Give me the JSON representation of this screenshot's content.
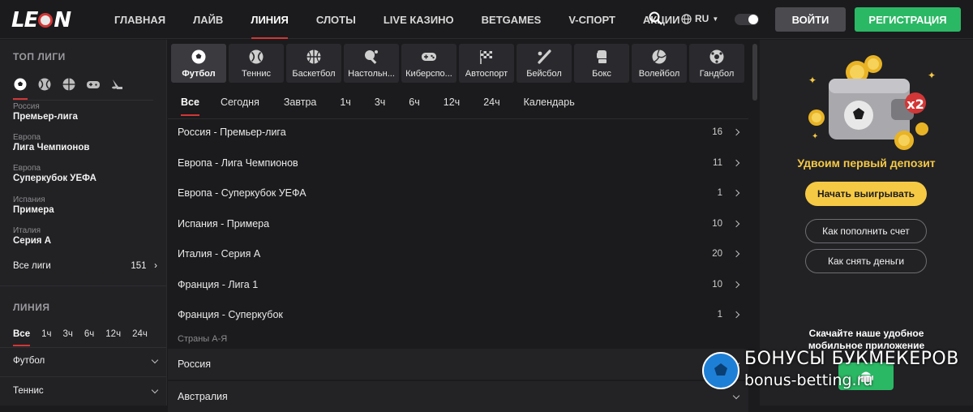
{
  "header": {
    "logo": "LEON",
    "nav": [
      "ГЛАВНАЯ",
      "ЛАЙВ",
      "ЛИНИЯ",
      "СЛОТЫ",
      "LIVE КАЗИНО",
      "BETGAMES",
      "V-СПОРТ",
      "АКЦИИ"
    ],
    "active_nav": "ЛИНИЯ",
    "lang": "RU",
    "login": "ВОЙТИ",
    "register": "РЕГИСТРАЦИЯ",
    "colors": {
      "accent": "#d23636",
      "green": "#2bb865",
      "yellow": "#f6c945"
    }
  },
  "sidebar": {
    "top_heading": "ТОП ЛИГИ",
    "top_leagues": [
      {
        "country": "Россия",
        "name": "Премьер-лига"
      },
      {
        "country": "Европа",
        "name": "Лига Чемпионов"
      },
      {
        "country": "Европа",
        "name": "Суперкубок УЕФА"
      },
      {
        "country": "Испания",
        "name": "Примера"
      },
      {
        "country": "Италия",
        "name": "Серия А"
      }
    ],
    "all_leagues_label": "Все лиги",
    "all_leagues_count": "151",
    "line_heading": "ЛИНИЯ",
    "time_filters": [
      "Все",
      "1ч",
      "3ч",
      "6ч",
      "12ч",
      "24ч"
    ],
    "sports": [
      "Футбол",
      "Теннис"
    ]
  },
  "sports_bar": [
    "Футбол",
    "Теннис",
    "Баскетбол",
    "Настольн...",
    "Киберспо...",
    "Автоспорт",
    "Бейсбол",
    "Бокс",
    "Волейбол",
    "Гандбол"
  ],
  "time_tabs": [
    "Все",
    "Сегодня",
    "Завтра",
    "1ч",
    "3ч",
    "6ч",
    "12ч",
    "24ч",
    "Календарь"
  ],
  "leagues": [
    {
      "name": "Россия - Премьер-лига",
      "count": "16"
    },
    {
      "name": "Европа - Лига Чемпионов",
      "count": "11"
    },
    {
      "name": "Европа - Суперкубок УЕФА",
      "count": "1"
    },
    {
      "name": "Испания - Примера",
      "count": "10"
    },
    {
      "name": "Италия - Серия А",
      "count": "20"
    },
    {
      "name": "Франция - Лига 1",
      "count": "10"
    },
    {
      "name": "Франция - Суперкубок",
      "count": "1"
    }
  ],
  "countries_label": "Страны А-Я",
  "countries": [
    "Россия",
    "Австралия"
  ],
  "promo": {
    "badge": "x2",
    "title": "Удвоим первый депозит",
    "cta": "Начать выигрывать",
    "how_deposit": "Как пополнить счет",
    "how_withdraw": "Как снять деньги",
    "download_line1": "Скачайте наше удобное",
    "download_line2": "мобильное приложение"
  },
  "watermark": {
    "line1": "БОНУСЫ БУКМЕКЕРОВ",
    "line2": "bonus-betting.ru"
  }
}
